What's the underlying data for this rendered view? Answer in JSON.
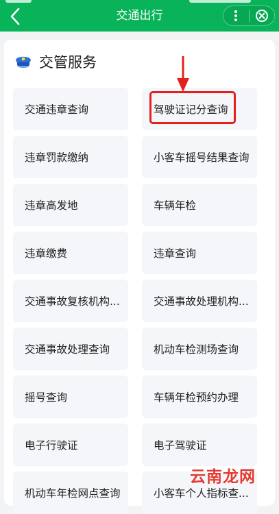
{
  "header": {
    "title": "交通出行"
  },
  "section": {
    "title": "交管服务",
    "icon": "police-cap-icon"
  },
  "services": [
    {
      "label": "交通违章查询"
    },
    {
      "label": "驾驶证记分查询"
    },
    {
      "label": "违章罚款缴纳"
    },
    {
      "label": "小客车摇号结果查询"
    },
    {
      "label": "违章高发地"
    },
    {
      "label": "车辆年检"
    },
    {
      "label": "违章缴费"
    },
    {
      "label": "违章查询"
    },
    {
      "label": "交通事故复核机构..."
    },
    {
      "label": "交通事故处理机构..."
    },
    {
      "label": "交通事故处理查询"
    },
    {
      "label": "机动车检测场查询"
    },
    {
      "label": "摇号查询"
    },
    {
      "label": "车辆年检预约办理"
    },
    {
      "label": "电子行驶证"
    },
    {
      "label": "电子驾驶证"
    },
    {
      "label": "机动车年检网点查询"
    },
    {
      "label": "小客车个人指标查..."
    }
  ],
  "annotation": {
    "highlighted": "驾驶证记分查询",
    "color": "#e4201c"
  },
  "watermark": {
    "text": "云南龙网"
  },
  "colors": {
    "header": "#08b35a",
    "background": "#f2f3f5",
    "tile": "#f4f6f9"
  }
}
